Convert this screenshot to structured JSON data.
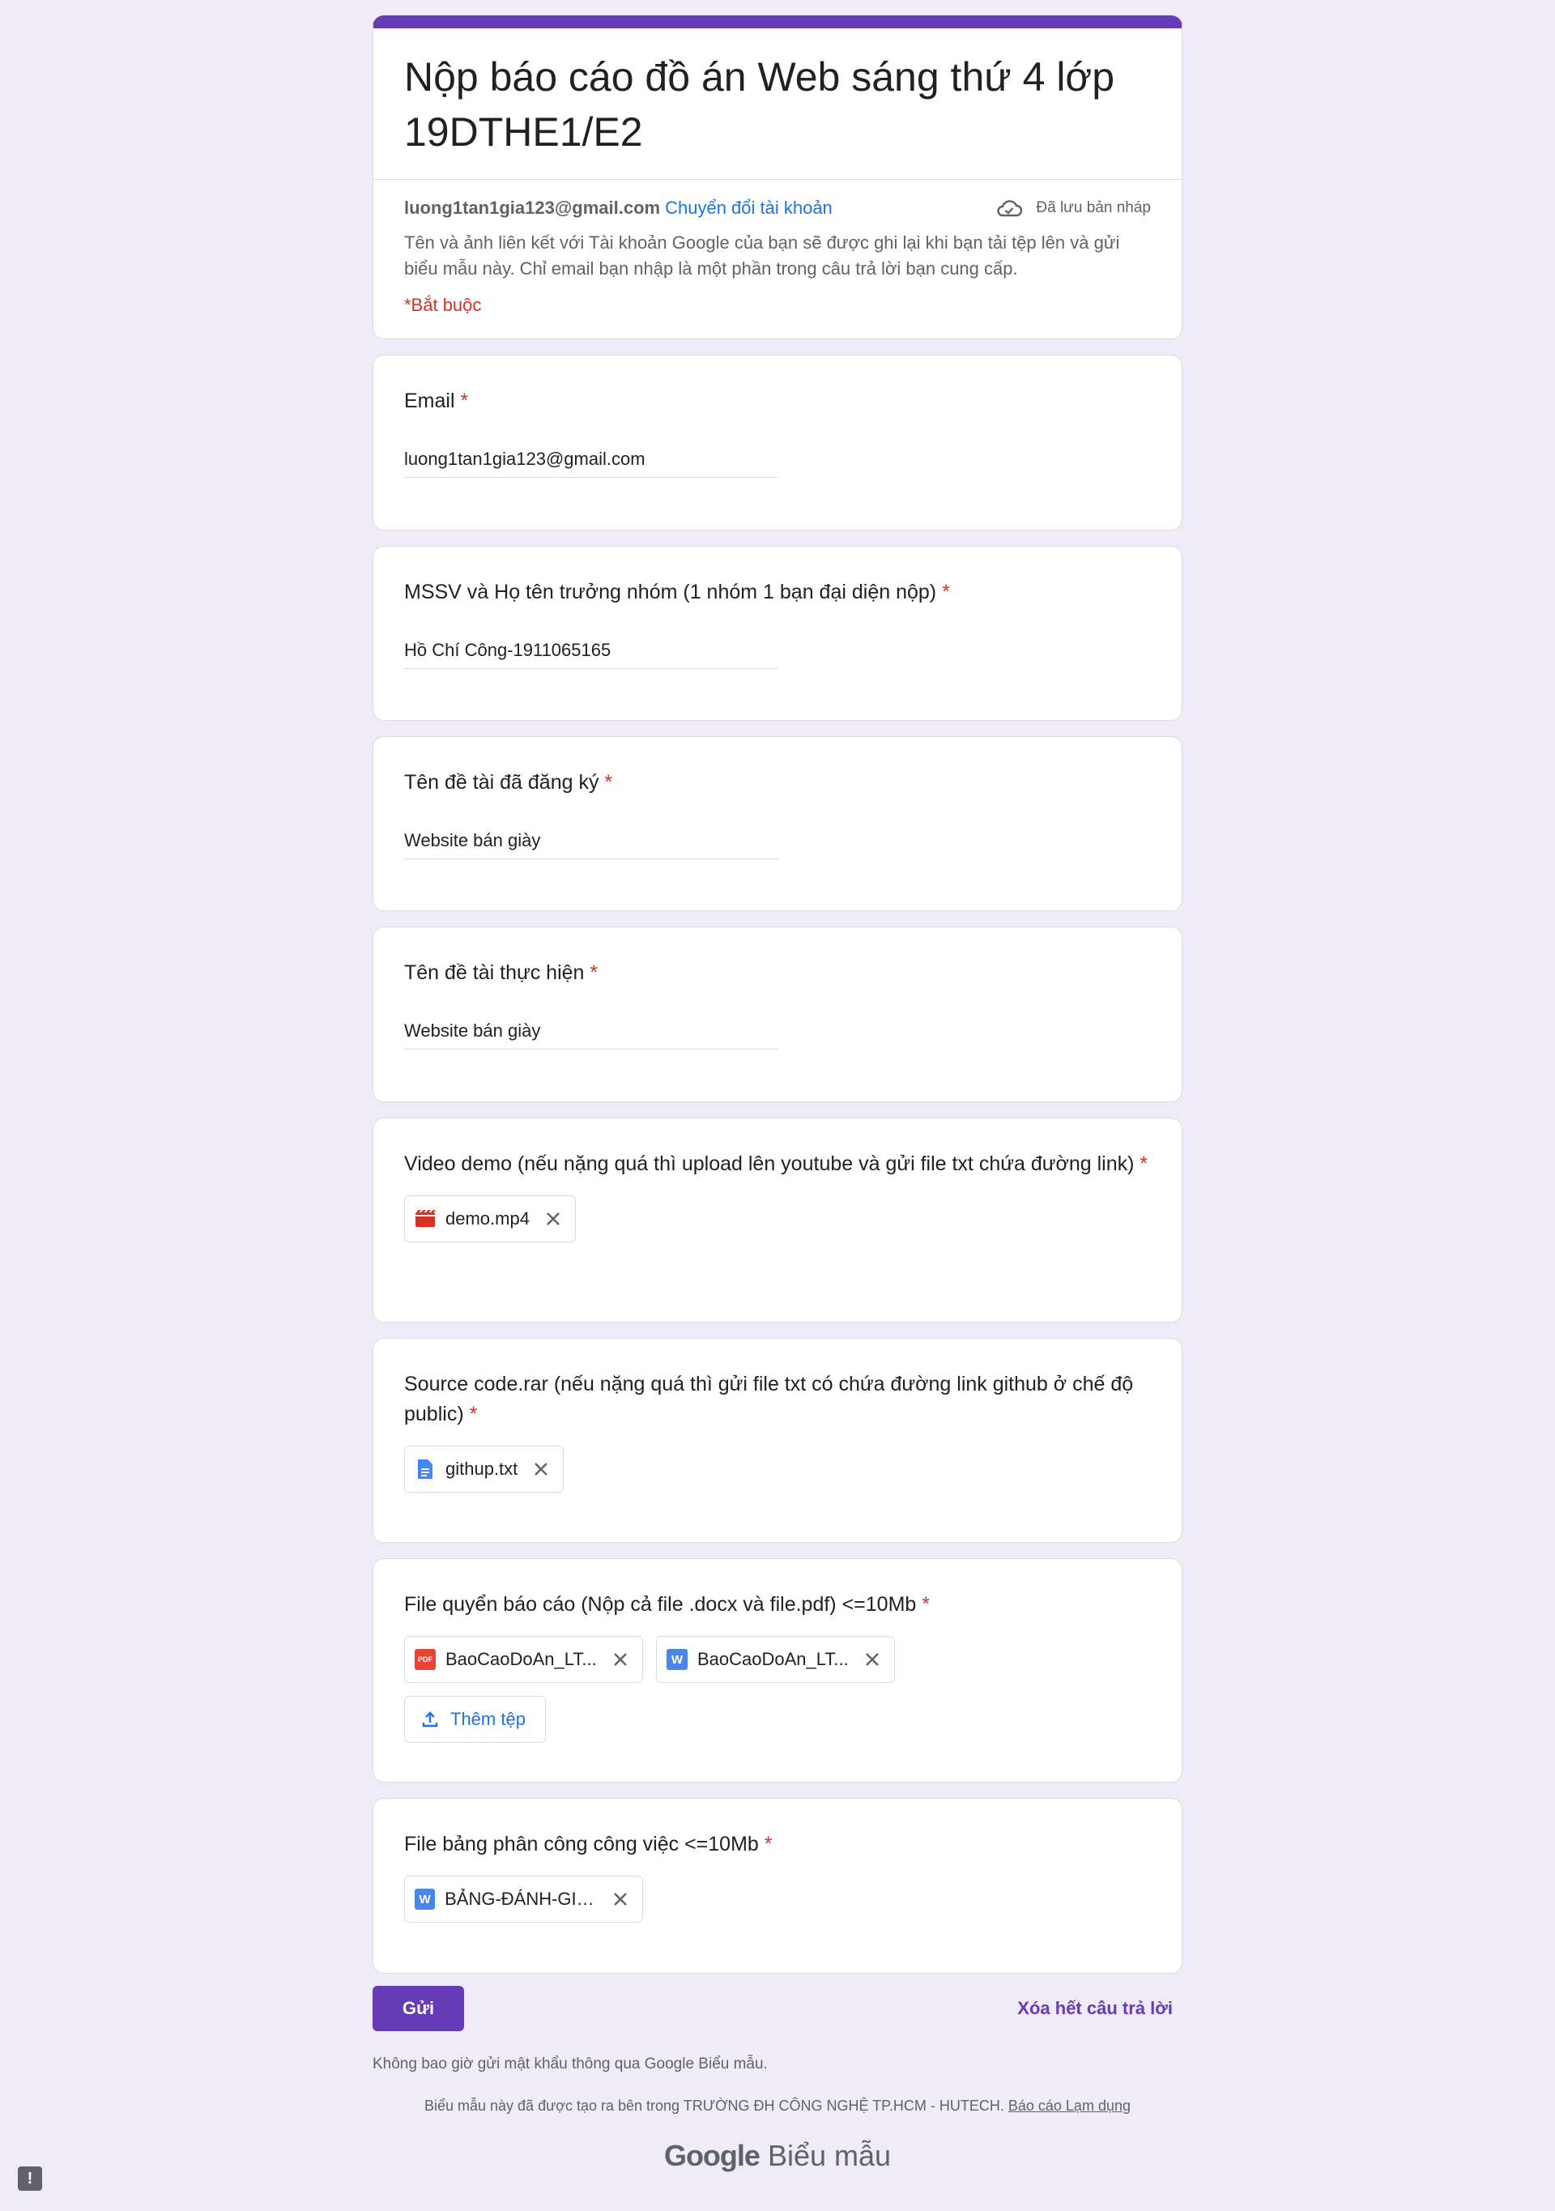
{
  "form": {
    "title": "Nộp báo cáo đồ án Web sáng thứ 4 lớp 19DTHE1/E2",
    "account_email": "luong1tan1gia123@gmail.com",
    "switch_account": "Chuyển đổi tài khoản",
    "draft_status": "Đã lưu bản nháp",
    "account_note": "Tên và ảnh liên kết với Tài khoản Google của bạn sẽ được ghi lại khi bạn tải tệp lên và gửi biểu mẫu này. Chỉ email bạn nhập là một phần trong câu trả lời bạn cung cấp.",
    "required_note": "*Bắt buộc"
  },
  "questions": {
    "email": {
      "title": "Email",
      "value": "luong1tan1gia123@gmail.com"
    },
    "mssv": {
      "title": "MSSV và Họ tên trưởng nhóm (1 nhóm 1 bạn đại diện nộp)",
      "value": "Hồ Chí Công-1911065165"
    },
    "registered_topic": {
      "title": "Tên đề tài đã đăng ký",
      "value": "Website bán giày"
    },
    "implemented_topic": {
      "title": "Tên đề tài thực hiện",
      "value": "Website bán giày"
    },
    "video": {
      "title": "Video demo (nếu nặng quá thì upload lên youtube và gửi file txt chứa đường link)",
      "file": "demo.mp4"
    },
    "source": {
      "title": "Source code.rar (nếu nặng quá thì gửi file txt có chứa đường link github ở chế độ public)",
      "file": "githup.txt"
    },
    "report": {
      "title": "File quyển báo cáo (Nộp cả file .docx và file.pdf) <=10Mb",
      "file_pdf": "BaoCaoDoAn_LT...",
      "file_docx": "BaoCaoDoAn_LT...",
      "add_file": "Thêm tệp"
    },
    "assignment": {
      "title": "File bảng phân công công việc <=10Mb",
      "file": "BẢNG-ĐÁNH-GIÁ..."
    }
  },
  "required_mark": "*",
  "actions": {
    "submit": "Gửi",
    "clear": "Xóa hết câu trả lời"
  },
  "footer": {
    "password_note": "Không bao giờ gửi mật khẩu thông qua Google Biểu mẫu.",
    "created_note": "Biểu mẫu này đã được tạo ra bên trong TRƯỜNG ĐH CÔNG NGHỆ TP.HCM - HUTECH.",
    "report_abuse": "Báo cáo Lạm dụng",
    "brand_google": "Google",
    "brand_forms": "Biểu mẫu"
  },
  "icons": {
    "cloud": "cloud-check-icon",
    "video": "video-file-icon",
    "doc": "google-doc-icon",
    "pdf": "pdf-file-icon",
    "word": "word-file-icon",
    "close": "close-icon",
    "upload": "upload-icon",
    "report": "report-problem-icon"
  },
  "colors": {
    "accent": "#673ab7",
    "link": "#1a73e8",
    "required": "#d93025",
    "background": "#efebf8"
  }
}
